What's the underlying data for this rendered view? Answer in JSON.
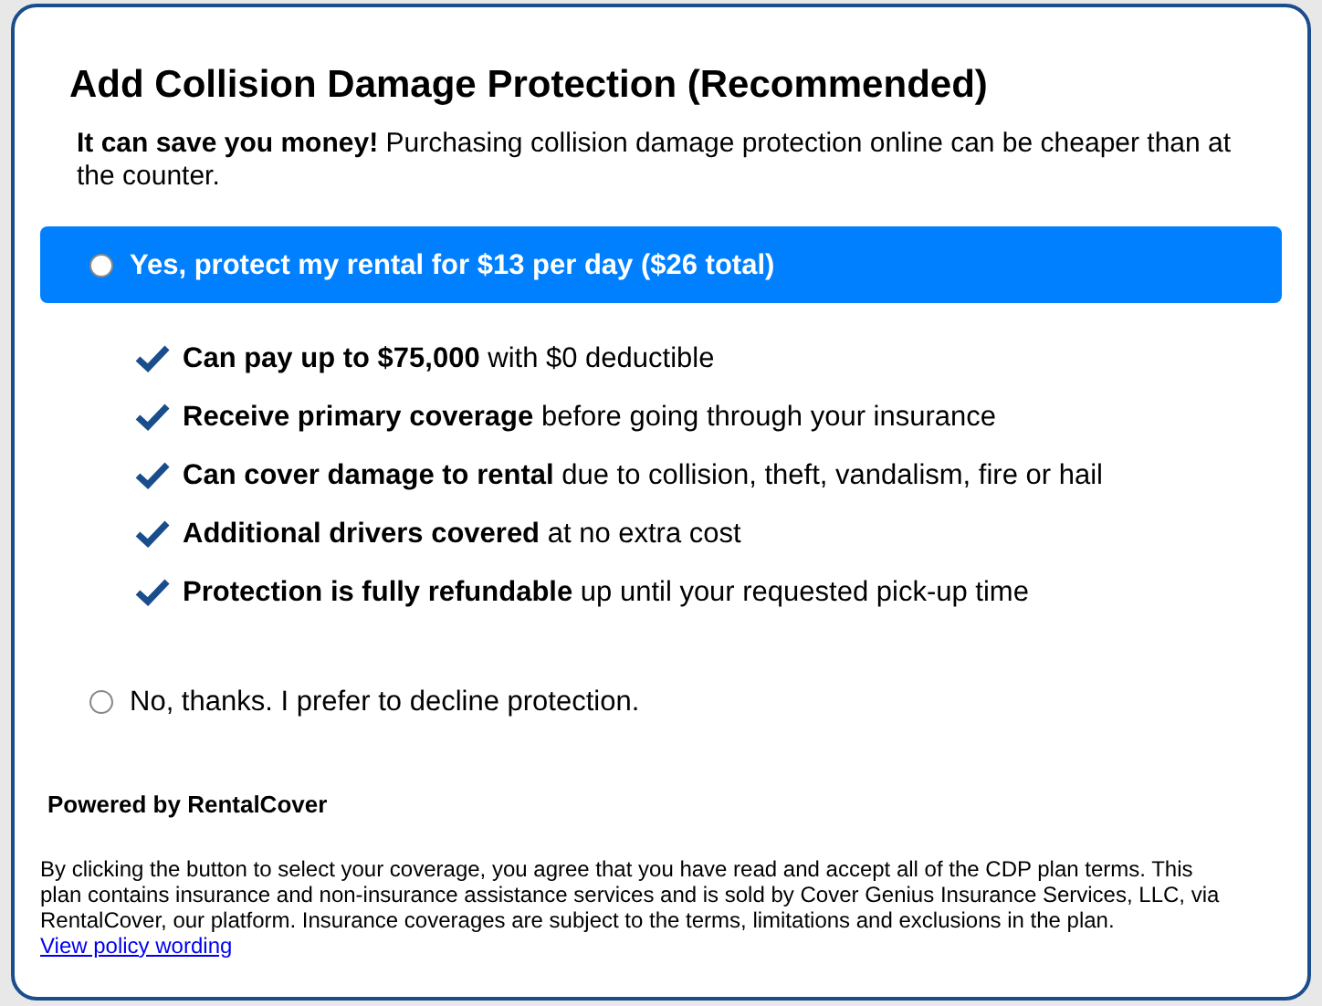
{
  "title": "Add Collision Damage Protection (Recommended)",
  "intro": "**It can save you money!** Purchasing collision damage protection online can be cheaper than at the counter.",
  "options": [
    {
      "label": "Yes, protect my rental for $13 per day ($26 total)",
      "selected": false,
      "highlighted": true,
      "benefits": [
        "**Can pay up to $75,000** with $0 deductible",
        "**Receive primary coverage** before going through your insurance",
        "**Can cover damage to rental** due to collision, theft, vandalism, fire or hail",
        "**Additional drivers covered** at no extra cost",
        "**Protection is fully refundable** up until your requested pick-up time"
      ]
    },
    {
      "label": "No, thanks. I prefer to decline protection.",
      "selected": false,
      "highlighted": false
    }
  ],
  "powered_by": "Powered by RentalCover",
  "disclaimer": "By clicking the button to select your coverage, you agree that you have read and accept all of the CDP plan terms. This plan contains insurance and non-insurance assistance services and is sold by Cover Genius Insurance Services, LLC, via RentalCover, our platform. Insurance coverages are subject to the terms, limitations and exclusions in the plan.",
  "policy_link": "View policy wording"
}
